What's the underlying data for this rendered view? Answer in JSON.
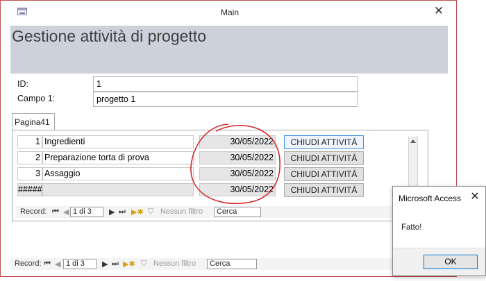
{
  "window": {
    "title": "Main"
  },
  "form": {
    "title": "Gestione attività di progetto",
    "fields": [
      {
        "label": "ID:",
        "value": "1"
      },
      {
        "label": "Campo 1:",
        "value": "progetto 1"
      }
    ],
    "tab_label": "Pagina41"
  },
  "subform": {
    "rows": [
      {
        "num": "1",
        "name": "Ingredienti",
        "date": "30/05/2022",
        "button": "CHIUDI ATTIVITÁ"
      },
      {
        "num": "2",
        "name": "Preparazione torta di prova",
        "date": "30/05/2022",
        "button": "CHIUDI ATTIVITÁ"
      },
      {
        "num": "3",
        "name": "Assaggio",
        "date": "30/05/2022",
        "button": "CHIUDI ATTIVITÁ"
      },
      {
        "num": "#####",
        "name": "",
        "date": "30/05/2022",
        "button": "CHIUDI ATTIVITÁ"
      }
    ],
    "nav": {
      "label": "Record:",
      "position": "1 di 3",
      "filter": "Nessun filtro",
      "search": "Cerca"
    }
  },
  "main_nav": {
    "label": "Record:",
    "position": "1 di 3",
    "filter": "Nessun filtro",
    "search": "Cerca"
  },
  "dialog": {
    "title": "Microsoft Access",
    "message": "Fatto!",
    "ok": "OK"
  },
  "colors": {
    "window_border": "#c0504d",
    "header_band": "#cdd1da",
    "annotation": "#d42a2a",
    "dialog_accent": "#0078d7"
  }
}
